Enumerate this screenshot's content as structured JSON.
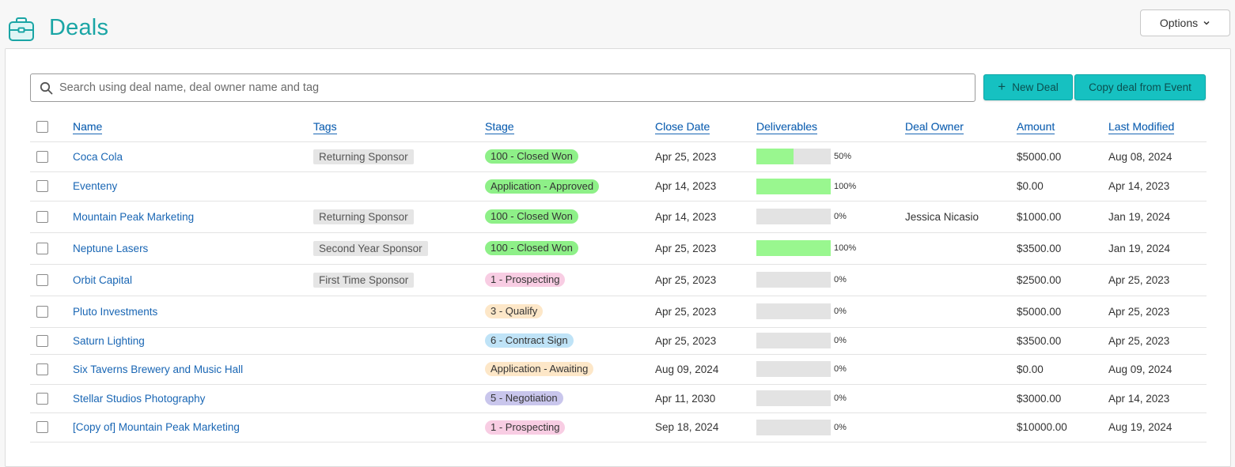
{
  "header": {
    "title": "Deals",
    "options_label": "Options"
  },
  "search": {
    "placeholder": "Search using deal name, deal owner name and tag"
  },
  "actions": {
    "new_deal_label": "New Deal",
    "copy_deal_label": "Copy deal from Event"
  },
  "columns": {
    "name": "Name",
    "tags": "Tags",
    "stage": "Stage",
    "close_date": "Close Date",
    "deliverables": "Deliverables",
    "deal_owner": "Deal Owner",
    "amount": "Amount",
    "last_modified": "Last Modified"
  },
  "colors": {
    "accent": "#1aa5a5",
    "button": "#16c1c1",
    "link": "#1966b4",
    "progress_fill": "#99f78f",
    "stage_closed_won": "#8ef088",
    "stage_approved": "#8ef088",
    "stage_prospecting": "#f8cde3",
    "stage_qualify": "#fde7c8",
    "stage_contract": "#bfe3f7",
    "stage_awaiting": "#fde7c8",
    "stage_negotiation": "#c9c6ec"
  },
  "rows": [
    {
      "name": "Coca Cola",
      "tag": "Returning Sponsor",
      "stage": "100 - Closed Won",
      "stage_color": "#8ef088",
      "close_date": "Apr 25, 2023",
      "deliverables": 0.5,
      "deliverables_label": "50%",
      "owner": "",
      "amount": "$5000.00",
      "last_modified": "Aug 08, 2024"
    },
    {
      "name": "Eventeny",
      "tag": "",
      "stage": "Application - Approved",
      "stage_color": "#8ef088",
      "close_date": "Apr 14, 2023",
      "deliverables": 1.0,
      "deliverables_label": "100%",
      "owner": "",
      "amount": "$0.00",
      "last_modified": "Apr 14, 2023"
    },
    {
      "name": "Mountain Peak Marketing",
      "tag": "Returning Sponsor",
      "stage": "100 - Closed Won",
      "stage_color": "#8ef088",
      "close_date": "Apr 14, 2023",
      "deliverables": 0.0,
      "deliverables_label": "0%",
      "owner": "Jessica Nicasio",
      "amount": "$1000.00",
      "last_modified": "Jan 19, 2024"
    },
    {
      "name": "Neptune Lasers",
      "tag": "Second Year Sponsor",
      "stage": "100 - Closed Won",
      "stage_color": "#8ef088",
      "close_date": "Apr 25, 2023",
      "deliverables": 1.0,
      "deliverables_label": "100%",
      "owner": "",
      "amount": "$3500.00",
      "last_modified": "Jan 19, 2024"
    },
    {
      "name": "Orbit Capital",
      "tag": "First Time Sponsor",
      "stage": "1 - Prospecting",
      "stage_color": "#f8cde3",
      "close_date": "Apr 25, 2023",
      "deliverables": 0.0,
      "deliverables_label": "0%",
      "owner": "",
      "amount": "$2500.00",
      "last_modified": "Apr 25, 2023"
    },
    {
      "name": "Pluto Investments",
      "tag": "",
      "stage": "3 - Qualify",
      "stage_color": "#fde7c8",
      "close_date": "Apr 25, 2023",
      "deliverables": 0.0,
      "deliverables_label": "0%",
      "owner": "",
      "amount": "$5000.00",
      "last_modified": "Apr 25, 2023"
    },
    {
      "name": "Saturn Lighting",
      "tag": "",
      "stage": "6 - Contract Sign",
      "stage_color": "#bfe3f7",
      "close_date": "Apr 25, 2023",
      "deliverables": 0.0,
      "deliverables_label": "0%",
      "owner": "",
      "amount": "$3500.00",
      "last_modified": "Apr 25, 2023"
    },
    {
      "name": "Six Taverns Brewery and Music Hall",
      "tag": "",
      "stage": "Application - Awaiting",
      "stage_color": "#fde7c8",
      "close_date": "Aug 09, 2024",
      "deliverables": 0.0,
      "deliverables_label": "0%",
      "owner": "",
      "amount": "$0.00",
      "last_modified": "Aug 09, 2024"
    },
    {
      "name": "Stellar Studios Photography",
      "tag": "",
      "stage": "5 - Negotiation",
      "stage_color": "#c9c6ec",
      "close_date": "Apr 11, 2030",
      "deliverables": 0.0,
      "deliverables_label": "0%",
      "owner": "",
      "amount": "$3000.00",
      "last_modified": "Apr 14, 2023"
    },
    {
      "name": "[Copy of] Mountain Peak Marketing",
      "tag": "",
      "stage": "1 - Prospecting",
      "stage_color": "#f8cde3",
      "close_date": "Sep 18, 2024",
      "deliverables": 0.0,
      "deliverables_label": "0%",
      "owner": "",
      "amount": "$10000.00",
      "last_modified": "Aug 19, 2024"
    }
  ]
}
